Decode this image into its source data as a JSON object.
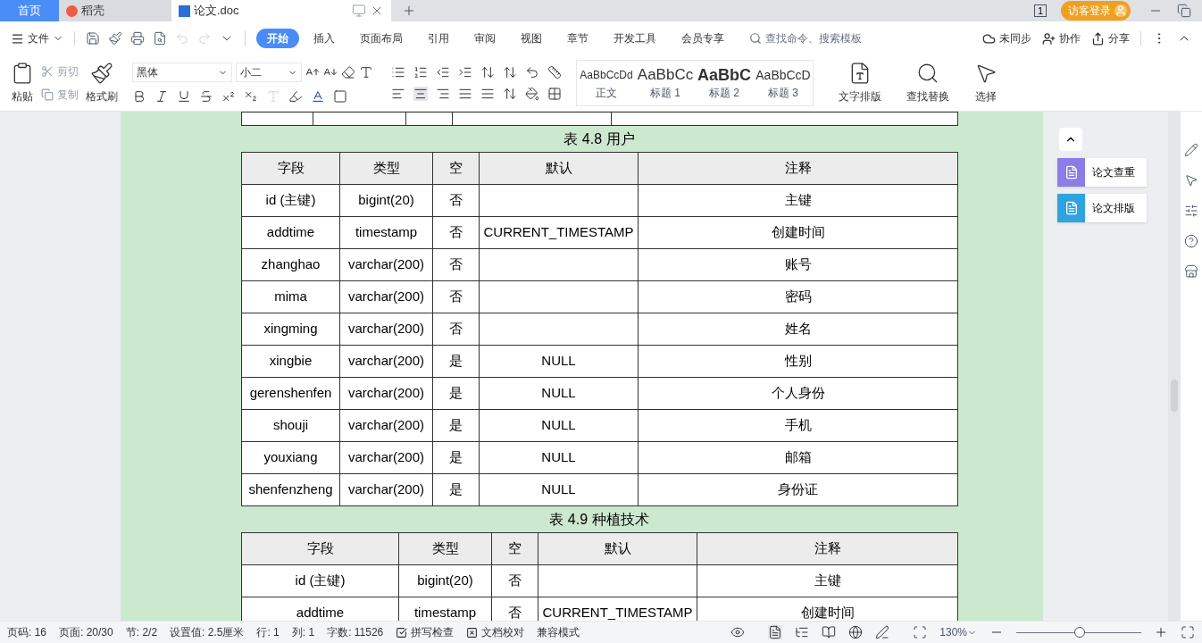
{
  "title_tabs": [
    {
      "label": "首页",
      "kind": "home",
      "selected": false
    },
    {
      "label": "稻壳",
      "kind": "docer",
      "selected": false
    },
    {
      "label": "论文.doc",
      "kind": "doc",
      "selected": true
    }
  ],
  "account": {
    "login": "访客登录",
    "page_count": "1"
  },
  "menu": {
    "file": "文件",
    "tabs": [
      {
        "label": "开始",
        "selected": true
      },
      {
        "label": "插入",
        "selected": false
      },
      {
        "label": "页面布局",
        "selected": false
      },
      {
        "label": "引用",
        "selected": false
      },
      {
        "label": "审阅",
        "selected": false
      },
      {
        "label": "视图",
        "selected": false
      },
      {
        "label": "章节",
        "selected": false
      },
      {
        "label": "开发工具",
        "selected": false
      },
      {
        "label": "会员专享",
        "selected": false
      }
    ],
    "search": {
      "placeholder": "查找命令、搜索模板"
    },
    "sync": "未同步",
    "collab": "协作",
    "share": "分享"
  },
  "ribbon": {
    "paste": "粘贴",
    "cut": {
      "label": "剪切",
      "disabled": true
    },
    "copy": {
      "label": "复制",
      "disabled": true
    },
    "format_painter": "格式刷",
    "font": "黑体",
    "size": "小二",
    "styles": [
      {
        "preview": "AaBbCcDd",
        "label": "正文",
        "kind": "body"
      },
      {
        "preview": "AaBbCc",
        "label": "标题 1",
        "kind": "h1"
      },
      {
        "preview": "AaBbC",
        "label": "标题 2",
        "kind": "h2"
      },
      {
        "preview": "AaBbCcD",
        "label": "标题 3",
        "kind": "h3"
      }
    ],
    "layout": "文字排版",
    "find": "查找替换",
    "select": "选择"
  },
  "tables": [
    {
      "caption": "表 4.8  用户",
      "columns": [
        "字段",
        "类型",
        "空",
        "默认",
        "注释"
      ],
      "rows": [
        [
          "id (主键)",
          "bigint(20)",
          "否",
          "",
          "主键"
        ],
        [
          "addtime",
          "timestamp",
          "否",
          "CURRENT_TIMESTAMP",
          "创建时间"
        ],
        [
          "zhanghao",
          "varchar(200)",
          "否",
          "",
          "账号"
        ],
        [
          "mima",
          "varchar(200)",
          "否",
          "",
          "密码"
        ],
        [
          "xingming",
          "varchar(200)",
          "否",
          "",
          "姓名"
        ],
        [
          "xingbie",
          "varchar(200)",
          "是",
          "NULL",
          "性别"
        ],
        [
          "gerenshenfen",
          "varchar(200)",
          "是",
          "NULL",
          "个人身份"
        ],
        [
          "shouji",
          "varchar(200)",
          "是",
          "NULL",
          "手机"
        ],
        [
          "youxiang",
          "varchar(200)",
          "是",
          "NULL",
          "邮箱"
        ],
        [
          "shenfenzheng",
          "varchar(200)",
          "是",
          "NULL",
          "身份证"
        ]
      ]
    },
    {
      "caption": "表 4.9  种植技术",
      "columns": [
        "字段",
        "类型",
        "空",
        "默认",
        "注释"
      ],
      "rows": [
        [
          "id (主键)",
          "bigint(20)",
          "否",
          "",
          "主键"
        ],
        [
          "addtime",
          "timestamp",
          "否",
          "CURRENT_TIMESTAMP",
          "创建时间"
        ]
      ]
    }
  ],
  "side_panel": [
    {
      "label": "论文查重",
      "color": "#8a7de8"
    },
    {
      "label": "论文排版",
      "color": "#2ea3e0"
    }
  ],
  "status_bar": {
    "items": [
      "页码: 16",
      "页面: 20/30",
      "节: 2/2",
      "设置值: 2.5厘米",
      "行: 1",
      "列: 1",
      "字数: 11526"
    ],
    "spell_check": "拼写检查",
    "proofread": "文档校对",
    "compat": "兼容模式",
    "zoom": "130%",
    "zoom_slider": {
      "level": 0.51
    }
  }
}
